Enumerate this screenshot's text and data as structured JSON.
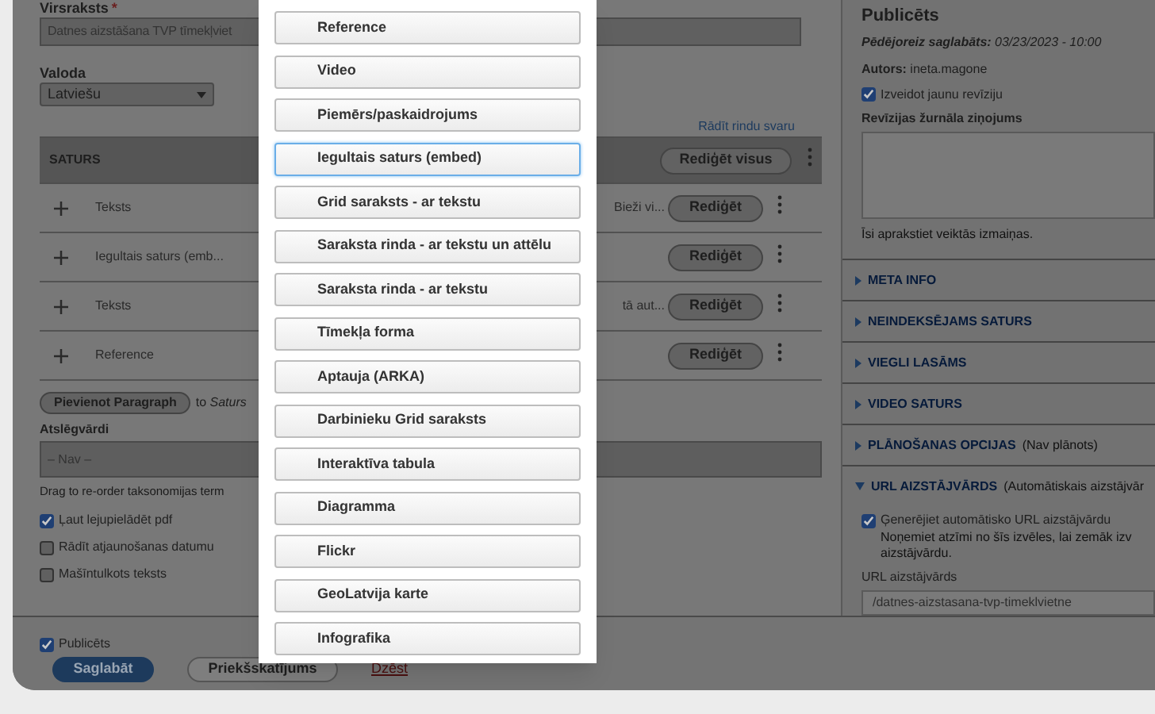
{
  "title_field": {
    "label": "Virsraksts",
    "required_mark": "*",
    "value": "Datnes aizstāšana TVP tīmekļviet"
  },
  "language": {
    "label": "Valoda",
    "value": "Latviešu"
  },
  "row_weights_link": "Rādīt rindu svaru",
  "content_table": {
    "heading": "SATURS",
    "edit_all": "Rediģēt visus",
    "rows": [
      {
        "label": "Teksts",
        "summary": "Bieži vi...",
        "edit": "Rediģēt"
      },
      {
        "label": "Iegultais saturs (emb...",
        "edit": "Rediģēt"
      },
      {
        "label": "Teksts",
        "summary": "tā aut...",
        "edit": "Rediģēt"
      },
      {
        "label": "Reference",
        "edit": "Rediģēt"
      }
    ]
  },
  "add_paragraph": {
    "button": "Pievienot Paragraph",
    "to": "to",
    "target": "Saturs"
  },
  "keywords": {
    "label": "Atslēgvārdi",
    "value": "– Nav –",
    "hint": "Drag to re-order taksonomijas term"
  },
  "options": [
    {
      "label": "Ļaut lejupielādēt pdf",
      "checked": true
    },
    {
      "label": "Rādīt atjaunošanas datumu",
      "checked": false
    },
    {
      "label": "Mašīntulkots teksts",
      "checked": false
    }
  ],
  "footer": {
    "published": {
      "label": "Publicēts",
      "checked": true
    },
    "save": "Saglabāt",
    "preview": "Priekšskatījums",
    "delete": "Dzēst"
  },
  "sidebar": {
    "heading": "Publicēts",
    "last_saved_label": "Pēdējoreiz saglabāts:",
    "last_saved": "03/23/2023 - 10:00",
    "author_label": "Autors:",
    "author": "ineta.magone",
    "new_revision": {
      "label": "Izveidot jaunu revīziju",
      "checked": true
    },
    "revision_log_label": "Revīzijas žurnāla ziņojums",
    "revision_log_hint": "Īsi aprakstiet veiktās izmaiņas.",
    "sections": [
      {
        "title": "META INFO",
        "expanded": false
      },
      {
        "title": "NEINDEKSĒJAMS SATURS",
        "expanded": false
      },
      {
        "title": "VIEGLI LASĀMS",
        "expanded": false
      },
      {
        "title": "VIDEO SATURS",
        "expanded": false
      },
      {
        "title": "PLĀNOŠANAS OPCIJAS",
        "note": "(Nav plānots)",
        "expanded": false
      },
      {
        "title": "URL AIZSTĀJVĀRDS",
        "note": "(Automātiskais aizstājvār",
        "expanded": true
      }
    ],
    "url_alias": {
      "generate": {
        "label": "Ģenerējiet automātisko URL aizstājvārdu",
        "checked": true
      },
      "description": "Noņemiet atzīmi no šīs izvēles, lai zemāk izv",
      "description_2": "aizstājvārdu.",
      "label": "URL aizstājvārds",
      "value": "/datnes-aizstasana-tvp-timeklvietne"
    }
  },
  "paragraph_dialog": {
    "items": [
      {
        "label": "Reference",
        "selected": false
      },
      {
        "label": "Video",
        "selected": false
      },
      {
        "label": "Piemērs/paskaidrojums",
        "selected": false
      },
      {
        "label": "Iegultais saturs (embed)",
        "selected": true
      },
      {
        "label": "Grid saraksts - ar tekstu",
        "selected": false
      },
      {
        "label": "Saraksta rinda - ar tekstu un attēlu",
        "selected": false
      },
      {
        "label": "Saraksta rinda - ar tekstu",
        "selected": false
      },
      {
        "label": "Tīmekļa forma",
        "selected": false
      },
      {
        "label": "Aptauja (ARKA)",
        "selected": false
      },
      {
        "label": "Darbinieku Grid saraksts",
        "selected": false
      },
      {
        "label": "Interaktīva tabula",
        "selected": false
      },
      {
        "label": "Diagramma",
        "selected": false
      },
      {
        "label": "Flickr",
        "selected": false
      },
      {
        "label": "GeoLatvija karte",
        "selected": false
      },
      {
        "label": "Infografika",
        "selected": false
      }
    ]
  }
}
